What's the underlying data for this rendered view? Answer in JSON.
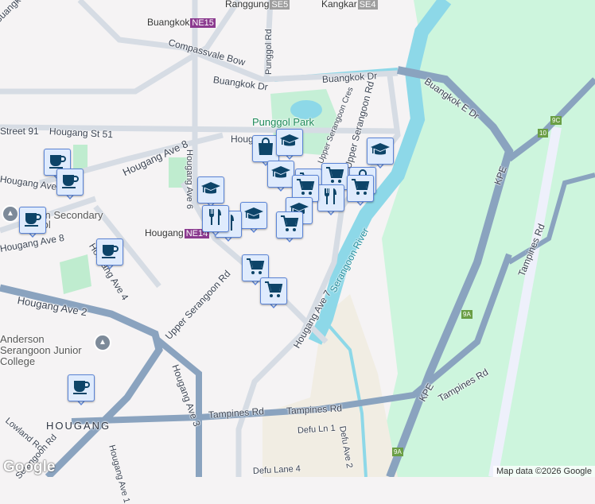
{
  "map": {
    "stations": [
      {
        "name": "Buangkok",
        "code": "NE15",
        "color": "#8b3a8f"
      },
      {
        "name": "Ranggung",
        "code": "SE5",
        "color": "#9e9e9e"
      },
      {
        "name": "Kangkar",
        "code": "SE4",
        "color": "#9e9e9e"
      },
      {
        "name": "Hougang",
        "code": "NE14",
        "color": "#8b3a8f"
      }
    ],
    "roads": {
      "buangkok_dr_nw": "Buangkok Dr",
      "buangkok_dr_1": "Buangkok Dr",
      "buangkok_dr_2": "Buangkok Dr",
      "buangkok_e_dr": "Buangkok E Dr",
      "compassvale_bow": "Compassvale Bow",
      "punggol_rd": "Punggol Rd",
      "street_91": "Street 91",
      "hougang_st_51": "Hougang St 51",
      "hougang_ave_8": "Hougang Ave 8",
      "hougang_ave_8b": "Hougang Ave 8",
      "hougang_ave_9": "Hougang Ave 9",
      "hougang_ave_6": "Hougang Ave 6",
      "hougang_top": "Houg",
      "hougang_ave_4": "Hougang Ave 4",
      "hougang_ave_2": "Hougang Ave 2",
      "hougang_ave_3": "Hougang Ave 3",
      "hougang_ave_7": "Hougang Ave 7",
      "hougang_ave_1": "Hougang Ave 1",
      "upper_serangoon_rd": "Upper Serangoon Rd",
      "upper_serangoon_rd_n": "Upper Serangoon Rd",
      "upper_serangoon_cres": "Upper Serangoon Cres",
      "tampines_rd_1": "Tampines Rd",
      "tampines_rd_2": "Tampines Rd",
      "tampines_rd_3": "Tampines Rd",
      "tampines_rd_4": "Tampines Rd",
      "kpe_1": "KPE",
      "kpe_2": "KPE",
      "lowland_rd": "Lowland Rd",
      "serangoon_rd": "Serangoon Rd",
      "defu_ln_1": "Defu Ln 1",
      "defu_lane_4": "Defu Lane 4",
      "defu_ave_2": "Defu Ave 2"
    },
    "places": {
      "punggol_park": "Punggol Park",
      "serangoon_river": "Serangoon River",
      "xinmin_school": "Xinmin Secondary School",
      "junior_college": "Anderson Serangoon Junior College",
      "hougang": "HOUGANG"
    },
    "exits": [
      "9C",
      "10",
      "9A",
      "9A"
    ],
    "markers": [
      {
        "type": "coffee"
      },
      {
        "type": "coffee"
      },
      {
        "type": "coffee"
      },
      {
        "type": "coffee"
      },
      {
        "type": "coffee"
      },
      {
        "type": "shopping"
      },
      {
        "type": "school"
      },
      {
        "type": "school"
      },
      {
        "type": "cart"
      },
      {
        "type": "cart"
      },
      {
        "type": "school"
      },
      {
        "type": "shopping"
      },
      {
        "type": "cart"
      },
      {
        "type": "restaurant"
      },
      {
        "type": "cart"
      },
      {
        "type": "school"
      },
      {
        "type": "cart"
      },
      {
        "type": "school"
      },
      {
        "type": "school"
      },
      {
        "type": "restaurant"
      },
      {
        "type": "restaurant"
      },
      {
        "type": "cart"
      },
      {
        "type": "cart"
      }
    ],
    "marker_colors": {
      "fill": "#dfebfd",
      "border": "#5b84d6",
      "icon": "#0d4468"
    },
    "attribution": "Map data ©2026 Google",
    "logo": "Google"
  }
}
